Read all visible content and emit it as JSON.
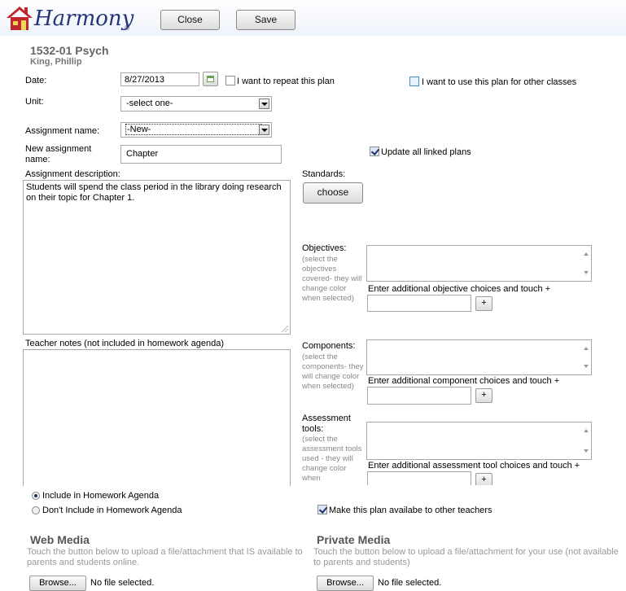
{
  "app": {
    "logo_text": "Harmony",
    "logo_mark": "®"
  },
  "toolbar": {
    "close_label": "Close",
    "save_label": "Save"
  },
  "course": {
    "name": "1532-01 Psych",
    "teacher": "King, Phillip"
  },
  "form": {
    "date_label": "Date:",
    "date_value": "8/27/2013",
    "repeat_label": "I want to repeat this plan",
    "other_classes_label": "I want to use this plan for other classes",
    "unit_label": "Unit:",
    "unit_value": "-select one-",
    "assignment_name_label": "Assignment name:",
    "assignment_name_value": "-New-",
    "new_assignment_label_line1": "New assignment",
    "new_assignment_label_line2": "name:",
    "new_assignment_value": "Chapter",
    "update_linked_label": "Update all linked plans",
    "description_label": "Assignment description:",
    "description_value": "Students will spend the class period in the library doing research on their topic for Chapter 1.",
    "teacher_notes_label": "Teacher notes (not included in homework agenda)",
    "standards_label": "Standards:",
    "choose_label": "choose"
  },
  "objectives": {
    "label": "Objectives:",
    "hint": "(select the objectives covered- they will change color when selected)",
    "add_prompt": "Enter additional objective choices and touch +",
    "plus": "+"
  },
  "components": {
    "label": "Components:",
    "hint": "(select the components- they will change color when selected)",
    "add_prompt": "Enter additional component choices and touch +",
    "plus": "+"
  },
  "assessment": {
    "label_line1": "Assessment",
    "label_line2": "tools:",
    "hint": "(select the assessment tools used - they will change color when",
    "add_prompt": "Enter additional assessment tool choices and touch +",
    "plus": "+"
  },
  "homework": {
    "include_label": "Include in Homework Agenda",
    "exclude_label": "Don't Include in Homework Agenda",
    "share_label": "Make this plan availabe to other teachers"
  },
  "web_media": {
    "title": "Web Media",
    "desc": "Touch the button below to upload a file/attachment that IS available to parents and students online.",
    "browse_label": "Browse...",
    "file_status": "No file selected."
  },
  "private_media": {
    "title": "Private Media",
    "desc": "Touch the button below to upload a file/attachment for your use (not available to parents and students)",
    "browse_label": "Browse...",
    "file_status": "No file selected."
  },
  "colors": {
    "brand_blue": "#24357a",
    "house_red": "#c0282d"
  }
}
